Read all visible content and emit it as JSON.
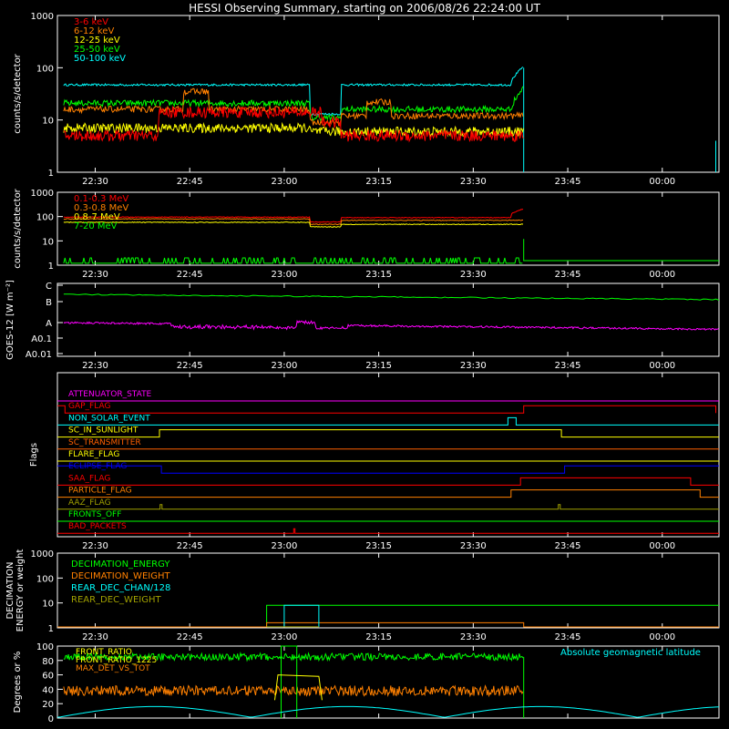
{
  "title": "HESSI Observing Summary, starting on 2006/08/26 22:24:00 UT",
  "colors": {
    "axis": "#ffffff",
    "red": "#ff0000",
    "orange": "#ff8000",
    "yellow": "#ffff00",
    "green": "#00ff00",
    "cyan": "#00ffff",
    "magenta": "#ff00ff",
    "blue": "#0000ff",
    "olive": "#a0a000",
    "darkorange": "#ff6000",
    "lightorange": "#ff9000"
  },
  "time_ticks": [
    "22:30",
    "22:45",
    "23:00",
    "23:15",
    "23:30",
    "23:45",
    "00:00"
  ],
  "chart_data": [
    {
      "id": "lowE",
      "type": "line",
      "ylabel": "counts/s/detector",
      "yscale": "log",
      "ylim": [
        1,
        1000
      ],
      "yticks": [
        "1",
        "10",
        "100",
        "1000"
      ],
      "series": [
        {
          "name": "3-6 keV",
          "color": "red"
        },
        {
          "name": "6-12 keV",
          "color": "orange"
        },
        {
          "name": "12-25 keV",
          "color": "yellow"
        },
        {
          "name": "25-50 keV",
          "color": "green"
        },
        {
          "name": "50-100 keV",
          "color": "cyan"
        }
      ]
    },
    {
      "id": "highE",
      "type": "line",
      "ylabel": "counts/s/detector",
      "yscale": "log",
      "ylim": [
        1,
        1000
      ],
      "yticks": [
        "1",
        "10",
        "100",
        "1000"
      ],
      "series": [
        {
          "name": "0.1-0.3 MeV",
          "color": "red"
        },
        {
          "name": "0.3-0.8 MeV",
          "color": "orange"
        },
        {
          "name": "0.8-7 MeV",
          "color": "yellow"
        },
        {
          "name": "7-20 MeV",
          "color": "green"
        }
      ]
    },
    {
      "id": "goes",
      "type": "line",
      "ylabel": "GOES-12 [W m⁻²]",
      "yticks": [
        "A0.01",
        "A0.1",
        "A",
        "B",
        "C"
      ]
    },
    {
      "id": "flags",
      "type": "line",
      "ylabel": "Flags",
      "flags": [
        {
          "name": "ATTENUATOR_STATE",
          "color": "magenta"
        },
        {
          "name": "GAP_FLAG",
          "color": "red"
        },
        {
          "name": "NON_SOLAR_EVENT",
          "color": "cyan"
        },
        {
          "name": "SC_IN_SUNLIGHT",
          "color": "yellow"
        },
        {
          "name": "SC_TRANSMITTER",
          "color": "darkorange"
        },
        {
          "name": "FLARE_FLAG",
          "color": "yellow"
        },
        {
          "name": "ECLIPSE_FLAG",
          "color": "blue"
        },
        {
          "name": "SAA_FLAG",
          "color": "red"
        },
        {
          "name": "PARTICLE_FLAG",
          "color": "orange"
        },
        {
          "name": "AAZ_FLAG",
          "color": "olive"
        },
        {
          "name": "FRONTS_OFF",
          "color": "green"
        },
        {
          "name": "BAD_PACKETS",
          "color": "red"
        }
      ]
    },
    {
      "id": "decim",
      "type": "line",
      "ylabel": "DECIMATION ENERGY or weight",
      "yscale": "log",
      "ylim": [
        1,
        1000
      ],
      "yticks": [
        "1",
        "10",
        "100",
        "1000"
      ],
      "series": [
        {
          "name": "DECIMATION_ENERGY",
          "color": "green"
        },
        {
          "name": "DECIMATION_WEIGHT",
          "color": "orange"
        },
        {
          "name": "REAR_DEC_CHAN/128",
          "color": "cyan"
        },
        {
          "name": "REAR_DEC_WEIGHT",
          "color": "olive"
        }
      ]
    },
    {
      "id": "ratio",
      "type": "line",
      "ylabel": "Degrees or %",
      "ylim": [
        0,
        100
      ],
      "yticks": [
        "0",
        "20",
        "40",
        "60",
        "80",
        "100"
      ],
      "series": [
        {
          "name": "FRONT_RATIO",
          "color": "green"
        },
        {
          "name": "FRONT_RATIO_1225",
          "color": "yellow"
        },
        {
          "name": "MAX_DET_VS_TOT",
          "color": "orange"
        },
        {
          "name": "Absolute geomagnetic latitude",
          "color": "cyan"
        }
      ]
    }
  ]
}
